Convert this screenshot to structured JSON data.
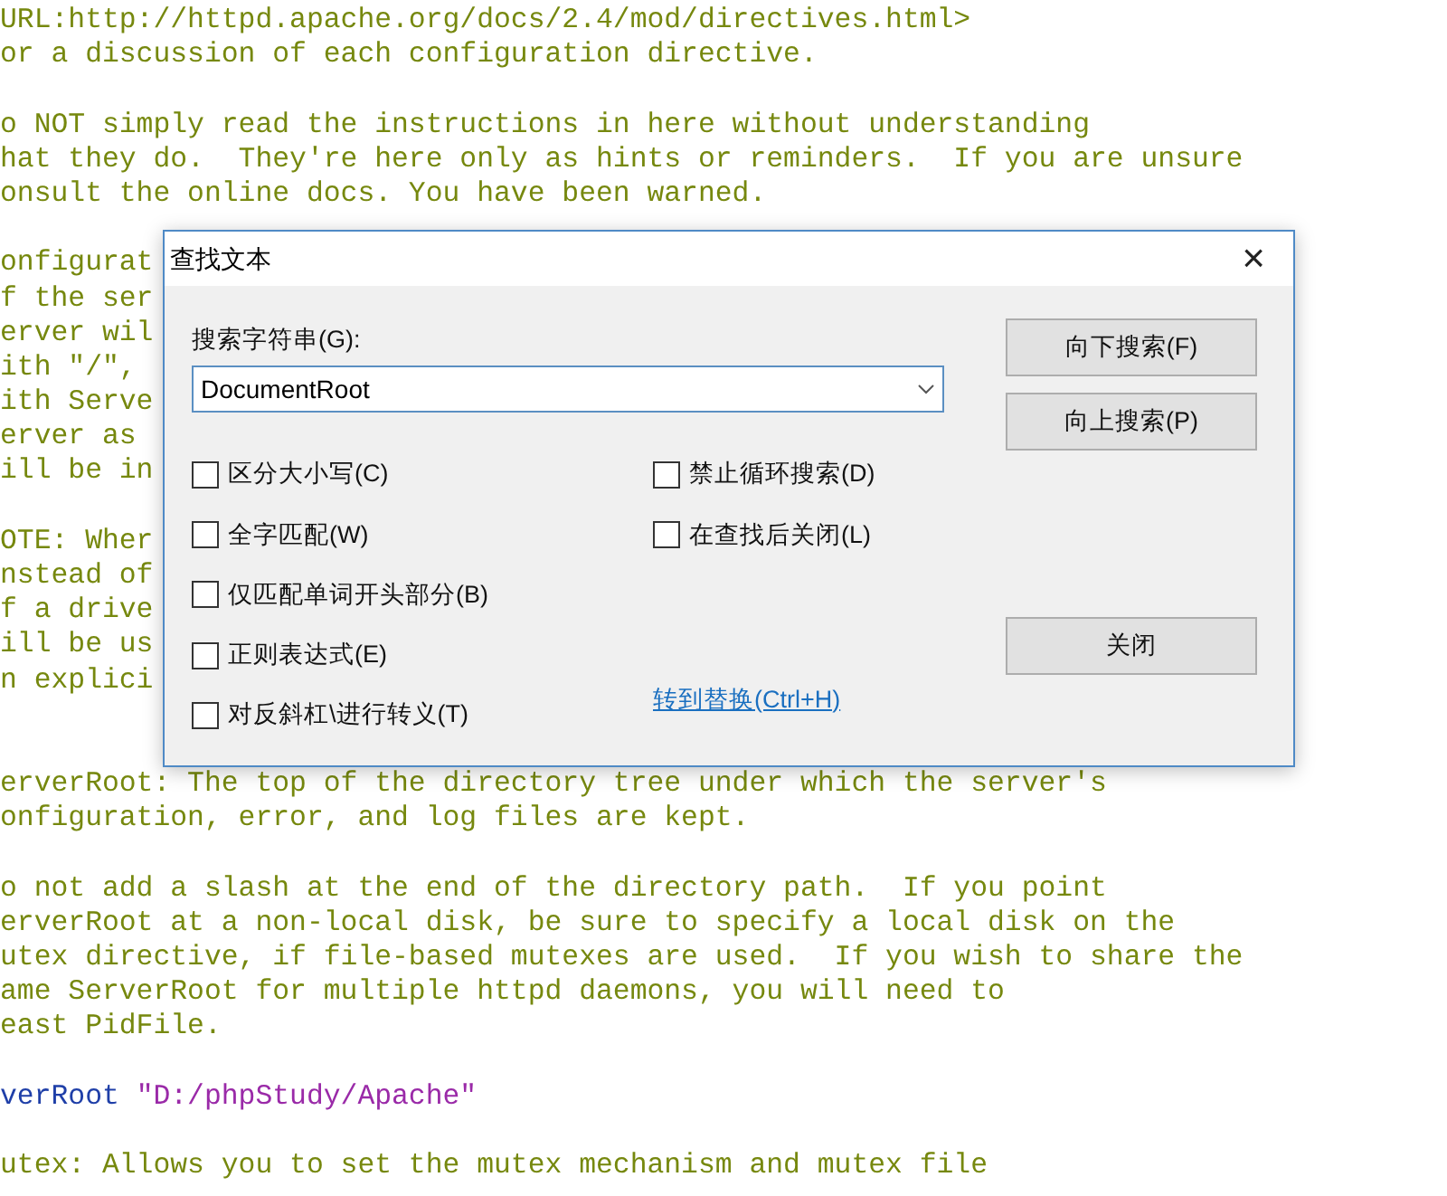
{
  "editor": {
    "lines": [
      {
        "kind": "code",
        "segments": [
          {
            "kind": "comment",
            "text": "URL:http://httpd.apache.org/docs/2.4/mod/directives.html>"
          }
        ]
      },
      {
        "kind": "code",
        "segments": [
          {
            "kind": "comment",
            "text": "or a discussion of each configuration directive."
          }
        ]
      },
      {
        "kind": "blank"
      },
      {
        "kind": "code",
        "segments": [
          {
            "kind": "comment",
            "text": "o NOT simply read the instructions in here without understanding"
          }
        ]
      },
      {
        "kind": "code",
        "segments": [
          {
            "kind": "comment",
            "text": "hat they do.  They're here only as hints or reminders.  If you are unsure"
          }
        ]
      },
      {
        "kind": "code",
        "segments": [
          {
            "kind": "comment",
            "text": "onsult the online docs. You have been warned."
          }
        ]
      },
      {
        "kind": "blank"
      },
      {
        "kind": "code",
        "segments": [
          {
            "kind": "comment",
            "text": "onfigurat"
          }
        ]
      },
      {
        "kind": "code",
        "segments": [
          {
            "kind": "comment",
            "text": "f the ser"
          }
        ]
      },
      {
        "kind": "code",
        "segments": [
          {
            "kind": "comment",
            "text": "erver wil"
          }
        ]
      },
      {
        "kind": "code",
        "segments": [
          {
            "kind": "comment",
            "text": "ith \"/\","
          }
        ]
      },
      {
        "kind": "code",
        "segments": [
          {
            "kind": "comment",
            "text": "ith Serve"
          }
        ]
      },
      {
        "kind": "code",
        "segments": [
          {
            "kind": "comment",
            "text": "erver as"
          }
        ]
      },
      {
        "kind": "code",
        "segments": [
          {
            "kind": "comment",
            "text": "ill be in"
          }
        ]
      },
      {
        "kind": "blank"
      },
      {
        "kind": "code",
        "segments": [
          {
            "kind": "comment",
            "text": "OTE: Wher"
          }
        ]
      },
      {
        "kind": "code",
        "segments": [
          {
            "kind": "comment",
            "text": "nstead of"
          }
        ]
      },
      {
        "kind": "code",
        "segments": [
          {
            "kind": "comment",
            "text": "f a drive"
          }
        ]
      },
      {
        "kind": "code",
        "segments": [
          {
            "kind": "comment",
            "text": "ill be us"
          }
        ]
      },
      {
        "kind": "code",
        "segments": [
          {
            "kind": "comment",
            "text": "n explici"
          }
        ]
      },
      {
        "kind": "blank"
      },
      {
        "kind": "blank"
      },
      {
        "kind": "code",
        "segments": [
          {
            "kind": "comment",
            "text": "erverRoot: The top of the directory tree under which the server's"
          }
        ]
      },
      {
        "kind": "code",
        "segments": [
          {
            "kind": "comment",
            "text": "onfiguration, error, and log files are kept."
          }
        ]
      },
      {
        "kind": "blank"
      },
      {
        "kind": "code",
        "segments": [
          {
            "kind": "comment",
            "text": "o not add a slash at the end of the directory path.  If you point"
          }
        ]
      },
      {
        "kind": "code",
        "segments": [
          {
            "kind": "comment",
            "text": "erverRoot at a non-local disk, be sure to specify a local disk on the"
          }
        ]
      },
      {
        "kind": "code",
        "segments": [
          {
            "kind": "comment",
            "text": "utex directive, if file-based mutexes are used.  If you wish to share the"
          }
        ]
      },
      {
        "kind": "code",
        "segments": [
          {
            "kind": "comment",
            "text": "ame ServerRoot for multiple httpd daemons, you will need to"
          }
        ]
      },
      {
        "kind": "code",
        "segments": [
          {
            "kind": "comment",
            "text": "east PidFile."
          }
        ]
      },
      {
        "kind": "blank"
      },
      {
        "kind": "code",
        "segments": [
          {
            "kind": "keyword",
            "text": "verRoot "
          },
          {
            "kind": "string",
            "text": "\"D:/phpStudy/Apache\""
          }
        ]
      },
      {
        "kind": "blank"
      },
      {
        "kind": "code",
        "segments": [
          {
            "kind": "comment",
            "text": "utex: Allows you to set the mutex mechanism and mutex file"
          }
        ]
      }
    ]
  },
  "dialog": {
    "title": "查找文本",
    "close": "×",
    "search_label": "搜索字符串(G):",
    "search_value": "DocumentRoot",
    "options_left": [
      {
        "label": "区分大小写(C)",
        "checked": false
      },
      {
        "label": "全字匹配(W)",
        "checked": false
      },
      {
        "label": "仅匹配单词开头部分(B)",
        "checked": false
      },
      {
        "label": "正则表达式(E)",
        "checked": false
      },
      {
        "label": "对反斜杠\\进行转义(T)",
        "checked": false
      }
    ],
    "options_right": [
      {
        "label": "禁止循环搜索(D)",
        "checked": false
      },
      {
        "label": "在查找后关闭(L)",
        "checked": false
      }
    ],
    "link": "转到替换(Ctrl+H)",
    "buttons": [
      {
        "label": "向下搜索(F)"
      },
      {
        "label": "向上搜索(P)"
      }
    ],
    "close_button": "关闭"
  }
}
